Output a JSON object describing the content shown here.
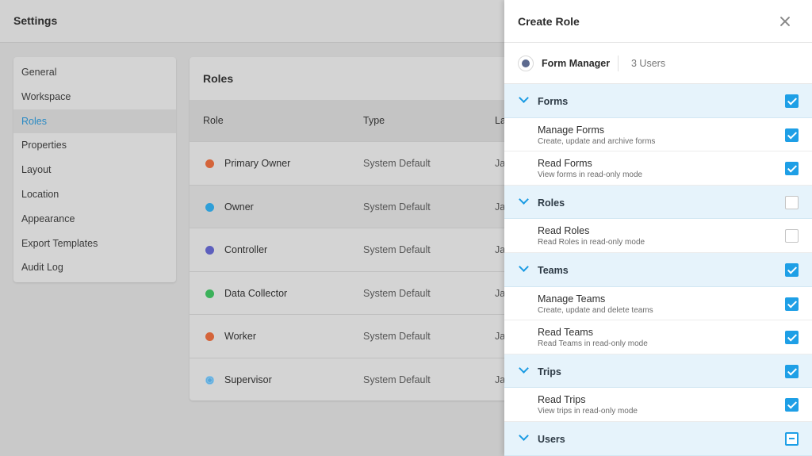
{
  "app": {
    "title": "Settings"
  },
  "sidebar": {
    "items": [
      {
        "label": "General"
      },
      {
        "label": "Workspace"
      },
      {
        "label": "Roles",
        "active": true
      },
      {
        "label": "Properties"
      },
      {
        "label": "Layout"
      },
      {
        "label": "Location"
      },
      {
        "label": "Appearance"
      },
      {
        "label": "Export Templates"
      },
      {
        "label": "Audit Log"
      }
    ]
  },
  "roles_card": {
    "title": "Roles",
    "columns": {
      "role": "Role",
      "type": "Type",
      "last": "La"
    },
    "rows": [
      {
        "name": "Primary Owner",
        "type": "System Default",
        "last": "Ja",
        "color": "#d4643a"
      },
      {
        "name": "Owner",
        "type": "System Default",
        "last": "Ja",
        "color": "#2f9fd8"
      },
      {
        "name": "Controller",
        "type": "System Default",
        "last": "Ja",
        "color": "#5d5fbd"
      },
      {
        "name": "Data Collector",
        "type": "System Default",
        "last": "Ja",
        "color": "#3bb15a"
      },
      {
        "name": "Worker",
        "type": "System Default",
        "last": "Ja",
        "color": "#d4643a"
      },
      {
        "name": "Supervisor",
        "type": "System Default",
        "last": "Ja",
        "color": "#56a6d9"
      }
    ]
  },
  "drawer": {
    "title": "Create Role",
    "close_icon": "close-icon",
    "role_name": "Form Manager",
    "user_count": "3 Users",
    "accent": "#1e9fe6",
    "groups": [
      {
        "label": "Forms",
        "state": "on",
        "permissions": [
          {
            "name": "Manage Forms",
            "desc": "Create, update and archive forms",
            "state": "on"
          },
          {
            "name": "Read Forms",
            "desc": "View forms in read-only mode",
            "state": "on"
          }
        ]
      },
      {
        "label": "Roles",
        "state": "off",
        "permissions": [
          {
            "name": "Read Roles",
            "desc": "Read Roles in read-only mode",
            "state": "off"
          }
        ]
      },
      {
        "label": "Teams",
        "state": "on",
        "permissions": [
          {
            "name": "Manage Teams",
            "desc": "Create, update and delete teams",
            "state": "on"
          },
          {
            "name": "Read Teams",
            "desc": "Read Teams in read-only mode",
            "state": "on"
          }
        ]
      },
      {
        "label": "Trips",
        "state": "on",
        "permissions": [
          {
            "name": "Read Trips",
            "desc": "View trips in read-only mode",
            "state": "on"
          }
        ]
      },
      {
        "label": "Users",
        "state": "partial",
        "permissions": []
      }
    ]
  }
}
